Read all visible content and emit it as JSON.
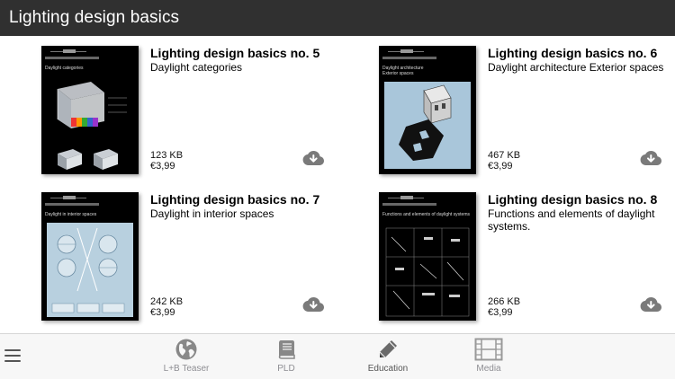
{
  "header": {
    "title": "Lighting design basics"
  },
  "items": [
    {
      "title": "Lighting design basics no. 5",
      "subtitle": "Daylight categories",
      "size": "123 KB",
      "price": "€3,99",
      "cover_text": "Daylight categories",
      "cover_bg": "#000000"
    },
    {
      "title": "Lighting design basics no. 6",
      "subtitle": "Daylight architecture Exterior spaces",
      "size": "467 KB",
      "price": "€3,99",
      "cover_text": "Daylight architecture Exterior spaces",
      "cover_bg": "#000000"
    },
    {
      "title": "Lighting design basics no. 7",
      "subtitle": "Daylight in interior spaces",
      "size": "242 KB",
      "price": "€3,99",
      "cover_text": "Daylight in interior spaces",
      "cover_bg": "#000000"
    },
    {
      "title": "Lighting design basics no. 8",
      "subtitle": "Functions and elements of daylight systems.",
      "size": "266 KB",
      "price": "€3,99",
      "cover_text": "Functions and elements of daylight systems",
      "cover_bg": "#000000"
    }
  ],
  "tabbar": {
    "menu_icon": "hamburger-menu-icon",
    "tabs": [
      {
        "label": "L+B Teaser",
        "icon": "globe-icon"
      },
      {
        "label": "PLD",
        "icon": "book-icon"
      },
      {
        "label": "Education",
        "icon": "pencil-icon",
        "active": true
      },
      {
        "label": "Media",
        "icon": "film-icon"
      }
    ]
  },
  "colors": {
    "header_bg": "#303030",
    "icon_gray": "#888888",
    "download_gray": "#7a7a7a",
    "tab_inactive": "#8e8e93",
    "tab_active": "#555555"
  }
}
